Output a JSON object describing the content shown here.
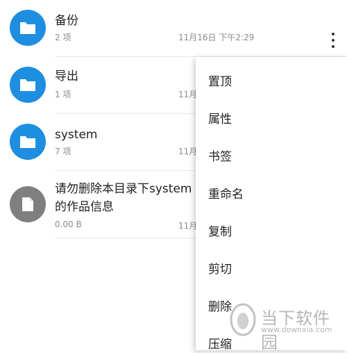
{
  "files": [
    {
      "name": "备份",
      "meta": "2 项",
      "date": "11月16日 下午2:29",
      "type": "folder"
    },
    {
      "name": "导出",
      "meta": "1 项",
      "date": "11月",
      "type": "folder"
    },
    {
      "name": "system",
      "meta": "7 项",
      "date": "11月",
      "type": "folder"
    },
    {
      "name_line1": "请勿删除本目录下system",
      "name_line2": "的作品信息",
      "meta": "0.00 B",
      "date": "11月",
      "type": "file"
    }
  ],
  "menu": {
    "items": [
      "置顶",
      "属性",
      "书签",
      "重命名",
      "复制",
      "剪切",
      "删除",
      "压缩"
    ]
  },
  "watermark": {
    "text": "当下软件园",
    "sub": "www.downxia.com"
  },
  "colors": {
    "folder": "#1e8ee0",
    "file": "#7f7f7f"
  },
  "icons": {
    "folder": "folder-icon",
    "file": "file-icon",
    "more": "more-vert-icon"
  }
}
